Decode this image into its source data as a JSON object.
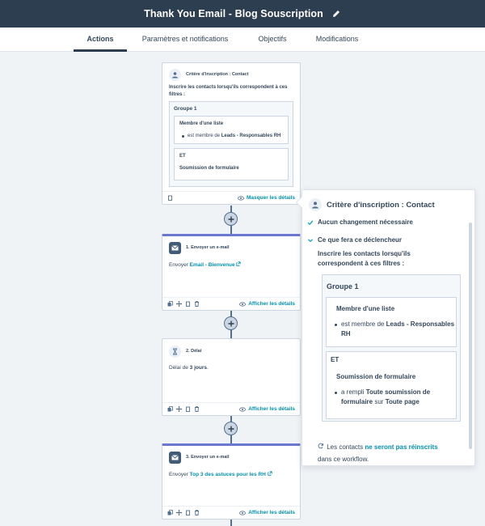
{
  "header": {
    "title": "Thank You Email - Blog Souscription"
  },
  "tabs": [
    {
      "label": "Actions"
    },
    {
      "label": "Paramètres et notifications"
    },
    {
      "label": "Objectifs"
    },
    {
      "label": "Modifications"
    }
  ],
  "trigger_card": {
    "title": "Critère d'inscription : Contact",
    "desc": "Inscrire les contacts lorsqu'ils correspondent à ces filtres :",
    "group": "Groupe 1",
    "filter1_title": "Membre d'une liste",
    "filter1_pre": "est membre de ",
    "filter1_bold": "Leads - Responsables RH",
    "et": "ET",
    "filter2_title": "Soumission de formulaire",
    "foot_link": "Masquer les détails"
  },
  "step1": {
    "title": "1. Envoyer un e-mail",
    "pre": "Envoyer ",
    "link": "Email - Bienvenue",
    "foot_link": "Afficher les détails"
  },
  "step2": {
    "title": "2. Délai",
    "pre": "Délai de ",
    "bold": "3 jours",
    "post": ".",
    "foot_link": "Afficher les détails"
  },
  "step3": {
    "title": "3. Envoyer un e-mail",
    "pre": "Envoyer ",
    "link": "Top 3 des astuces pour les RH",
    "foot_link": "Afficher les détails"
  },
  "panel": {
    "title": "Critère d'inscription : Contact",
    "row1": "Aucun changement nécessaire",
    "row2": "Ce que fera ce déclencheur",
    "desc": "Inscrire les contacts lorsqu'ils correspondent à ces filtres :",
    "group": "Groupe 1",
    "f1_title": "Membre d'une liste",
    "f1_pre": "est membre de ",
    "f1_bold": "Leads - Responsables RH",
    "et": "ET",
    "f2_title": "Soumission de formulaire",
    "f2_pre": "a rempli ",
    "f2_bold1": "Toute soumission de formulaire",
    "f2_mid": " sur ",
    "f2_bold2": "Toute page",
    "re_pre": "Les contacts ",
    "re_link": "ne seront pas réinscrits",
    "re_post": "dans ce workflow."
  },
  "colors": {
    "topbar": "#2d3e50",
    "accent_link": "#0091ae",
    "action_border": "#6a78d1"
  },
  "icons": [
    "pencil-icon",
    "contact-icon",
    "email-icon",
    "hourglass-icon",
    "eye-icon",
    "copy-icon",
    "move-icon",
    "clone-icon",
    "trash-icon",
    "plus-icon",
    "check-icon",
    "chevron-down-icon",
    "refresh-icon",
    "external-link-icon"
  ]
}
